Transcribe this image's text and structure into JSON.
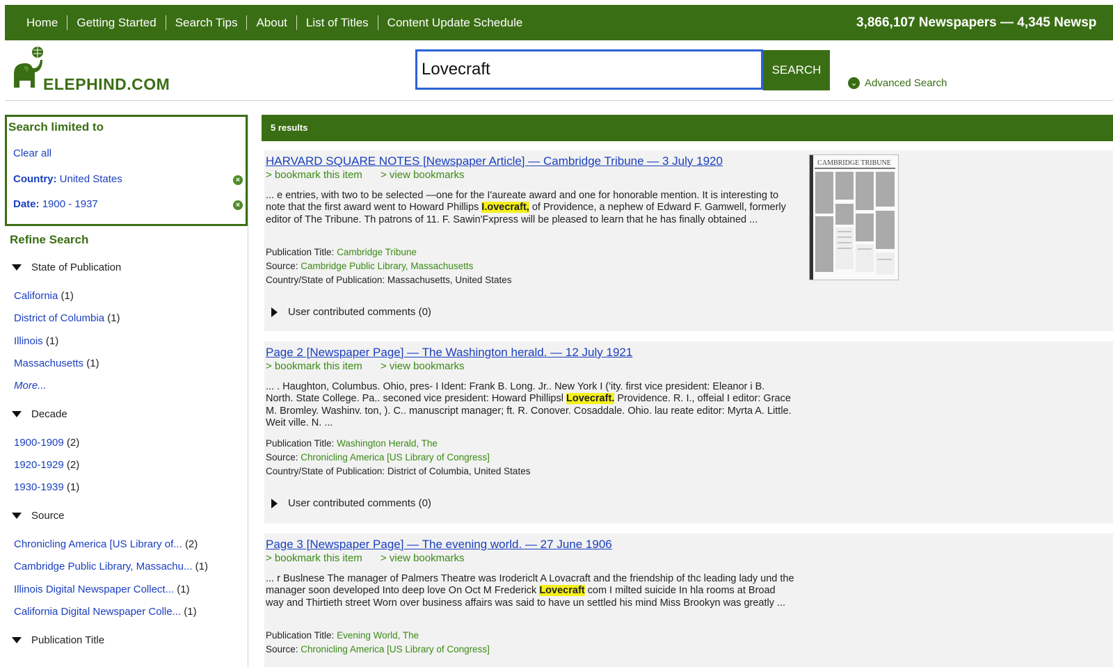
{
  "nav": {
    "items": [
      "Home",
      "Getting Started",
      "Search Tips",
      "About",
      "List of Titles",
      "Content Update Schedule"
    ],
    "counts": "3,866,107 Newspapers — 4,345 Newsp"
  },
  "header": {
    "logo_text": "ELEPHIND.COM",
    "search_value": "Lovecraft",
    "search_button": "SEARCH",
    "advanced_search": "Advanced Search"
  },
  "sidebar": {
    "limited_title": "Search limited to",
    "clear_all": "Clear all",
    "filters": [
      {
        "label": "Country:",
        "value": "United States"
      },
      {
        "label": "Date:",
        "value": "1900 - 1937"
      }
    ],
    "refine_title": "Refine Search",
    "facets": {
      "state": {
        "title": "State of Publication",
        "items": [
          {
            "name": "California",
            "count": "(1)"
          },
          {
            "name": "District of Columbia",
            "count": "(1)"
          },
          {
            "name": "Illinois",
            "count": "(1)"
          },
          {
            "name": "Massachusetts",
            "count": "(1)"
          }
        ],
        "more": "More..."
      },
      "decade": {
        "title": "Decade",
        "items": [
          {
            "name": "1900-1909",
            "count": "(2)"
          },
          {
            "name": "1920-1929",
            "count": "(2)"
          },
          {
            "name": "1930-1939",
            "count": "(1)"
          }
        ]
      },
      "source": {
        "title": "Source",
        "items": [
          {
            "name": "Chronicling America [US Library of...",
            "count": "(2)"
          },
          {
            "name": "Cambridge Public Library, Massachu...",
            "count": "(1)"
          },
          {
            "name": "Illinois Digital Newspaper Collect...",
            "count": "(1)"
          },
          {
            "name": "California Digital Newspaper Colle...",
            "count": "(1)"
          }
        ]
      },
      "pubtitle": {
        "title": "Publication Title"
      }
    }
  },
  "results": {
    "count_label": "5 results",
    "bookmark_label": "> bookmark this item",
    "view_bookmarks_label": "> view bookmarks",
    "pub_title_label": "Publication Title:",
    "source_label": "Source:",
    "country_label": "Country/State of Publication:",
    "items": [
      {
        "title": "HARVARD SQUARE NOTES [Newspaper Article] — Cambridge Tribune — 3 July 1920",
        "snippet_before": "... e entries, with two to be selected —one for the I'aureate award and one for honorable mention. It is interesting to note that the first award went to Howard Phillips ",
        "highlight": "I.ovecraft,",
        "snippet_after": " of Providence, a nephew of Edward F. Gamwell, formerly editor of The Tribune. Th patrons of 11. F. Sawin'Fxpress will be pleased to learn that he has finally obtained ...",
        "pub_title": "Cambridge Tribune",
        "source": "Cambridge Public Library, Massachusetts",
        "country": "Massachusetts, United States",
        "comments": "User contributed comments (0)",
        "thumb_masthead": "CAMBRIDGE TRIBUNE"
      },
      {
        "title": "Page 2 [Newspaper Page] — The Washington herald. — 12 July 1921",
        "snippet_before": "... . Haughton, Columbus. Ohio, pres- I Ident: Frank B. Long. Jr.. New York I ('ity. first vice president: Eleanor i B. North. State College. Pa.. seconed vice president: Howard Phillipsl ",
        "highlight": "Lovecraft.",
        "snippet_after": " Providence. R. I., offeial I editor: Grace M. Bromley. Washinv. ton, ). C.. manuscript manager; ft. R. Conover. Cosaddale. Ohio. lau reate editor: Myrta A. Little. Weit ville. N. ...",
        "pub_title": "Washington Herald, The",
        "source": "Chronicling America [US Library of Congress]",
        "country": "District of Columbia, United States",
        "comments": "User contributed comments (0)"
      },
      {
        "title": "Page 3 [Newspaper Page] — The evening world. — 27 June 1906",
        "snippet_before": "... r Buslnese The manager of Palmers Theatre was Irodericlt A Lovacraft and the friendship of thc leading lady und the manager soon developed Into deep love On Oct M Frederick ",
        "highlight": "Lovecraft",
        "snippet_after": " com I milted suicide In hla rooms at Broad way and Thirtieth street Worn over business affairs was said to have un settled his mind Miss Brookyn was greatly ...",
        "pub_title": "Evening World, The",
        "source": "Chronicling America [US Library of Congress]"
      }
    ]
  },
  "colors": {
    "brand_green": "#3a6e14",
    "link_blue": "#1a3fbf",
    "highlight": "#f5f01a"
  }
}
